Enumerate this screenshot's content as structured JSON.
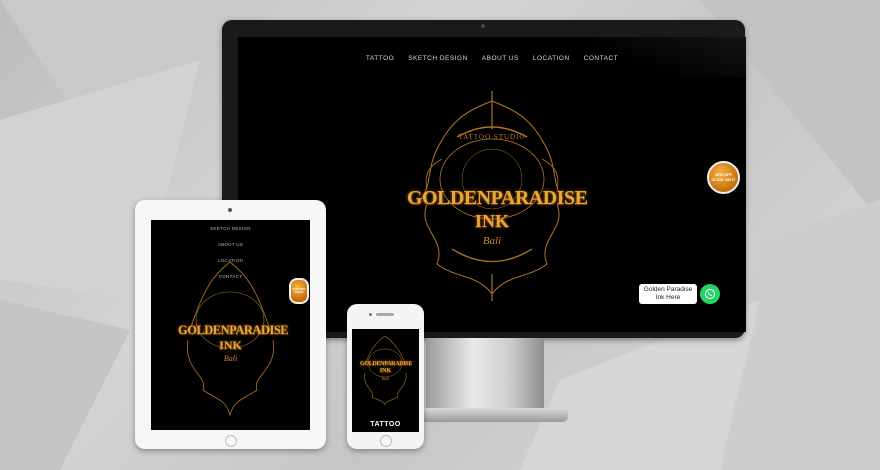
{
  "desktop": {
    "nav": [
      "TATTOO",
      "SKETCH DESIGN",
      "ABOUT US",
      "LOCATION",
      "CONTACT"
    ],
    "logo": {
      "top": "TATTOO STUDIO",
      "title_line1": "GOLDENPARADISE",
      "title_line2": "INK",
      "subtitle": "Bali"
    },
    "promo": "10% OFF\nCLICK ON IT",
    "chat": {
      "label": "Golden Paradise Ink Here"
    }
  },
  "tablet": {
    "menu": [
      "SKETCH DESIGN",
      "ABOUT US",
      "LOCATION",
      "CONTACT"
    ],
    "logo": {
      "title_line1": "GOLDENPARADISE",
      "title_line2": "INK",
      "subtitle": "Bali"
    },
    "promo": "10% OFF\nCLICK"
  },
  "phone": {
    "logo": {
      "title_line1": "GOLDENPARADISE",
      "title_line2": "INK",
      "subtitle": "Bali"
    },
    "title": "TATTOO"
  },
  "colors": {
    "gold": "#e0a43a",
    "whatsapp": "#25d366",
    "screen": "#000000"
  }
}
